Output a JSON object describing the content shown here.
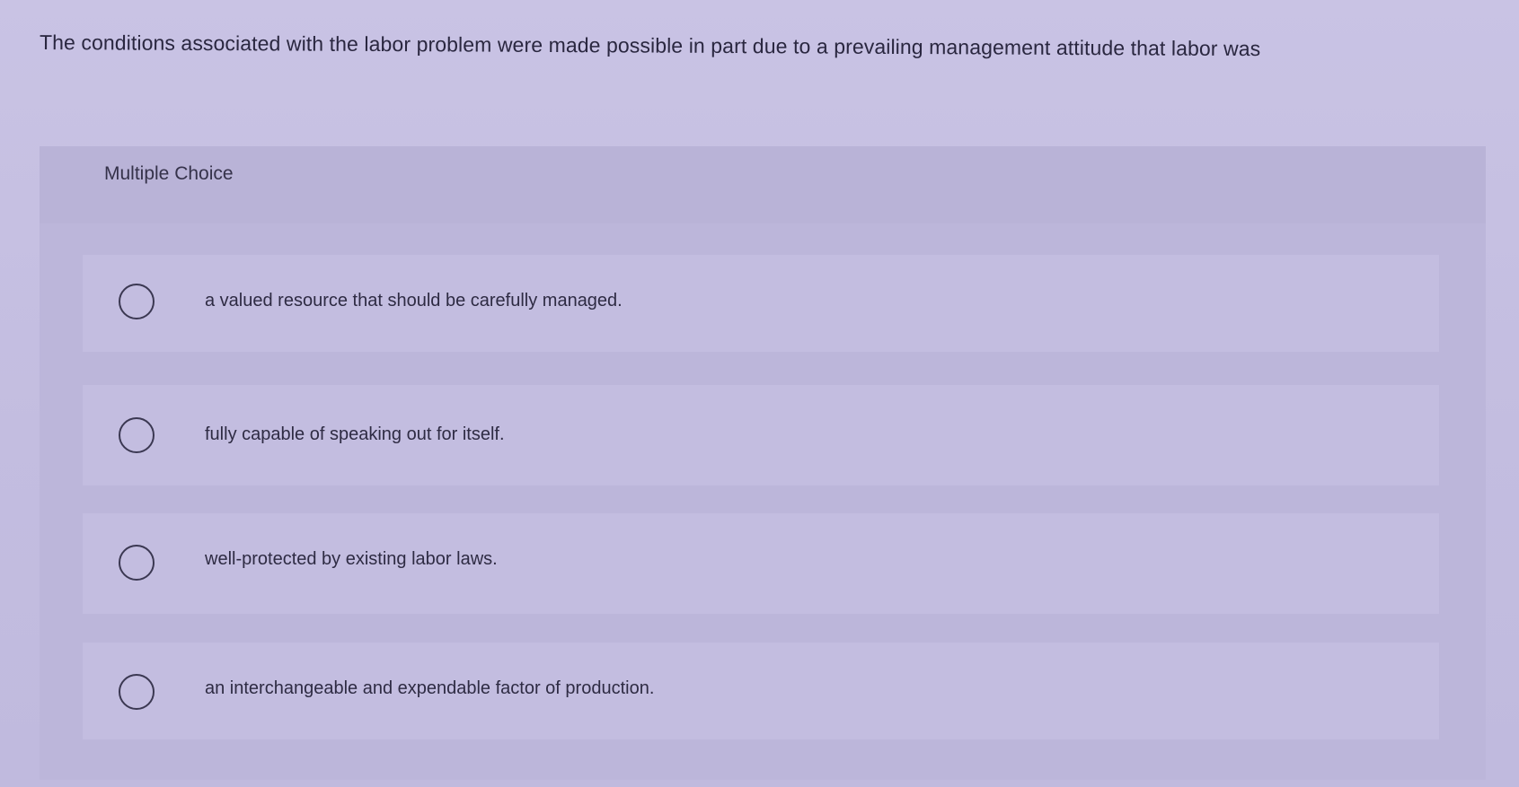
{
  "question": {
    "text": "The conditions associated with the labor problem were made possible in part due to a prevailing management attitude that labor was"
  },
  "multiple_choice": {
    "header_label": "Multiple Choice",
    "options": [
      {
        "label": "a valued resource that should be carefully managed.",
        "selected": false
      },
      {
        "label": "fully capable of speaking out for itself.",
        "selected": false
      },
      {
        "label": "well-protected by existing labor laws.",
        "selected": false
      },
      {
        "label": "an interchangeable and expendable factor of production.",
        "selected": false
      }
    ]
  },
  "colors": {
    "background": "#c6c0e2",
    "panel": "#bdb7db",
    "option_row": "#c3bde0",
    "text": "#2a2740"
  }
}
